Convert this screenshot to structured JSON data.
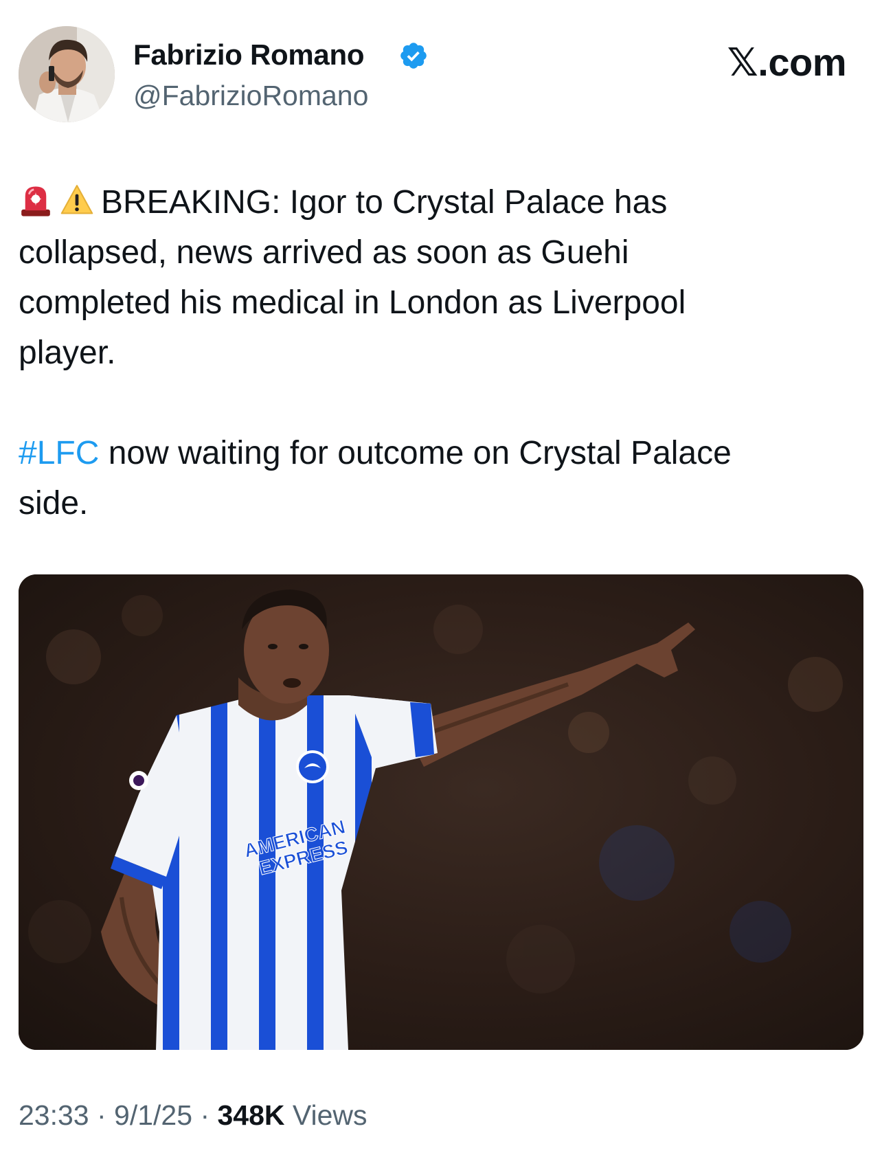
{
  "author": {
    "name": "Fabrizio Romano",
    "handle": "@FabrizioRomano",
    "verified": true,
    "avatar_icon": "profile-photo"
  },
  "brand": "𝕏.com",
  "tweet": {
    "emojis": [
      "police-light-emoji",
      "warning-emoji"
    ],
    "paragraph1_lines": [
      "BREAKING: Igor to Crystal Palace has",
      "collapsed, news arrived as soon as Guehi",
      "completed his medical in London as Liverpool",
      "player."
    ],
    "hashtag": "#LFC",
    "paragraph2_line1_rest": " now waiting for outcome on Crystal Palace",
    "paragraph2_line2": "side."
  },
  "media": {
    "kit_sponsor_line1": "AMERICAN",
    "kit_sponsor_line2": "EXPRESS"
  },
  "footer": {
    "time": "23:33",
    "separator": " · ",
    "date": "9/1/25",
    "views_count": "348K",
    "views_label": " Views"
  },
  "colors": {
    "link": "#1d9bf0",
    "verified": "#1d9bf0",
    "muted_text": "#536471",
    "kit_blue": "#1a4fd6"
  }
}
